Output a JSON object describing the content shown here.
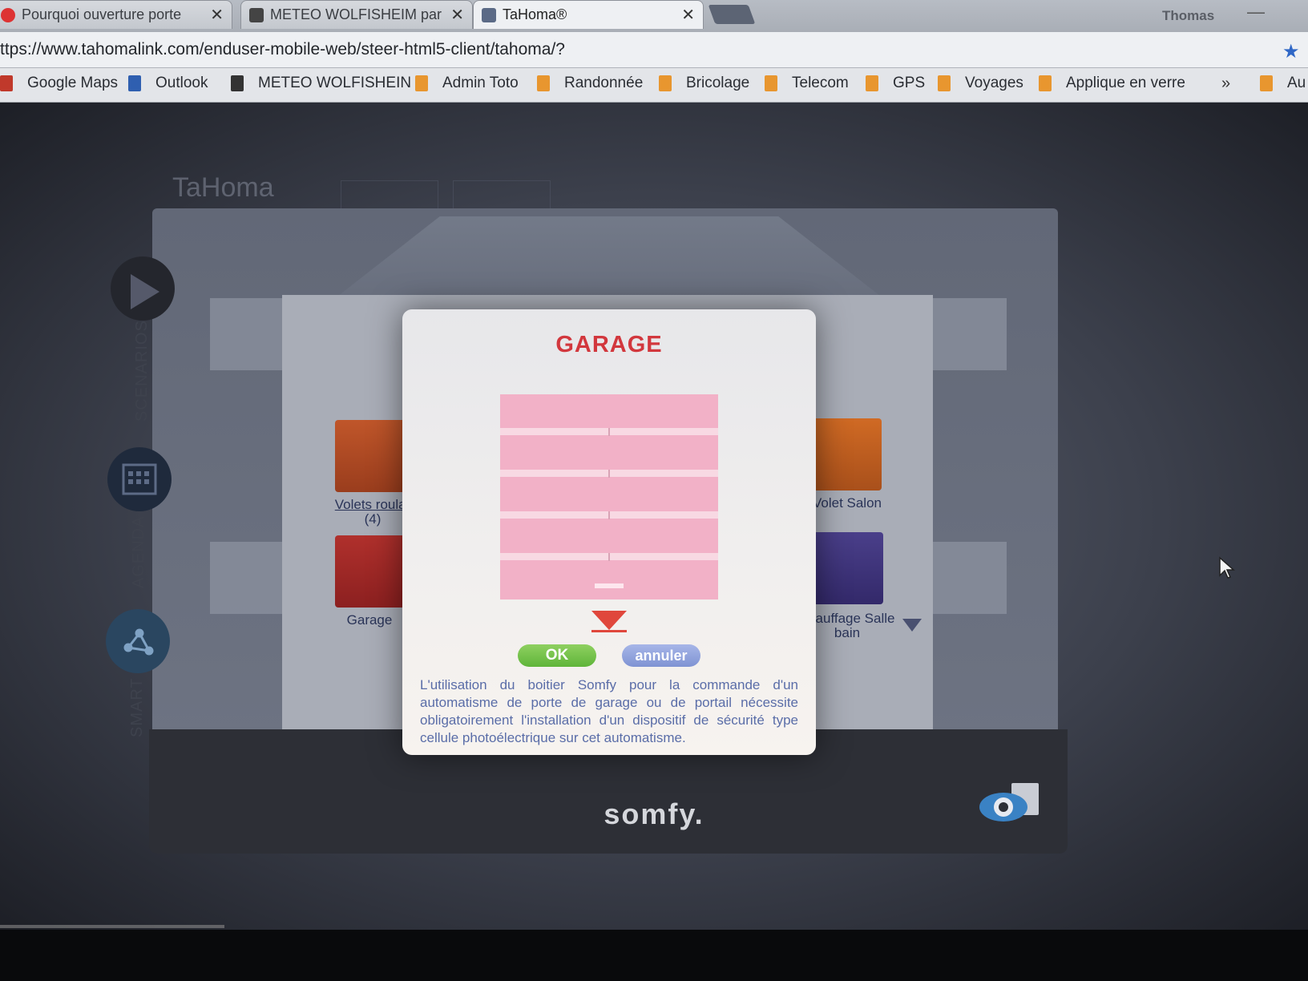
{
  "browser": {
    "tabs": [
      {
        "label": "Pourquoi ouverture porte",
        "close": "✕"
      },
      {
        "label": "METEO WOLFISHEIM par",
        "close": "✕"
      },
      {
        "label": "TaHoma®",
        "close": "✕"
      }
    ],
    "user": "Thomas",
    "minimize": "—",
    "url": "ttps://www.tahomalink.com/enduser-mobile-web/steer-html5-client/tahoma/?",
    "bookmarks": [
      {
        "label": "Google Maps",
        "icon": "maps-icon"
      },
      {
        "label": "Outlook",
        "icon": "outlook-icon"
      },
      {
        "label": "METEO WOLFISHEIN",
        "icon": "meteo-icon"
      },
      {
        "label": "Admin Toto",
        "icon": "folder-icon"
      },
      {
        "label": "Randonnée",
        "icon": "folder-icon"
      },
      {
        "label": "Bricolage",
        "icon": "folder-icon"
      },
      {
        "label": "Telecom",
        "icon": "folder-icon"
      },
      {
        "label": "GPS",
        "icon": "folder-icon"
      },
      {
        "label": "Voyages",
        "icon": "folder-icon"
      },
      {
        "label": "Applique en verre",
        "icon": "folder-icon"
      }
    ],
    "more": "»",
    "bookmark_tail": "Au"
  },
  "app": {
    "logo": "TaHoma",
    "side": {
      "scenarios": "SCENARIOS",
      "agenda": "AGENDA",
      "smart": "SMART"
    },
    "devices": {
      "volets": "Volets roular",
      "volets_count": "(4)",
      "garage": "Garage",
      "volet_salon": "Volet Salon",
      "chauffage_line1": "auffage Salle",
      "chauffage_line2": "bain"
    },
    "brand": "somfy."
  },
  "modal": {
    "title": "GARAGE",
    "ok_label": "OK",
    "cancel_label": "annuler",
    "warning": "L'utilisation du boitier Somfy pour la commande d'un automatisme de porte de garage ou de portail nécessite obligatoirement l'installation d'un dispositif de sécurité type cellule photoélectrique sur cet automatisme.",
    "colors": {
      "title": "#d2373d",
      "door": "#f2b1c7",
      "ok": "#5fb53a",
      "cancel": "#7f93d3",
      "text": "#5a6da8"
    }
  }
}
